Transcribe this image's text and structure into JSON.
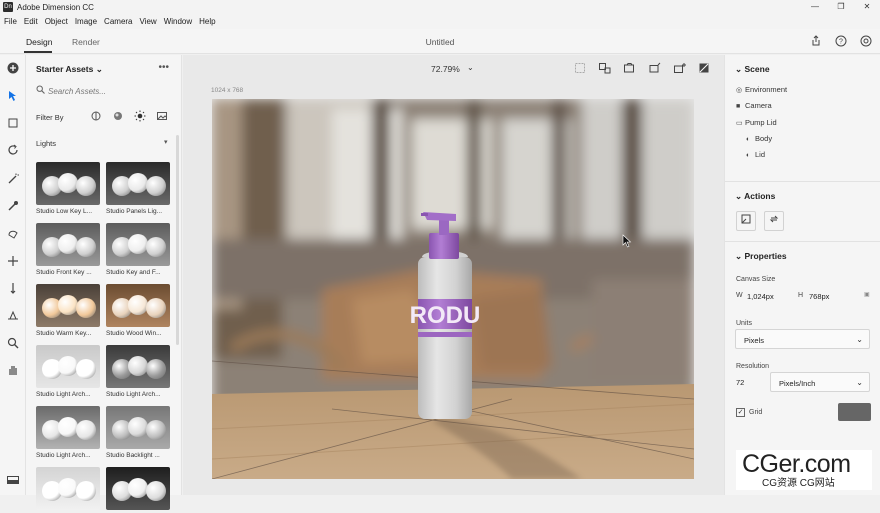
{
  "window": {
    "title": "Adobe Dimension CC",
    "app_icon": "Dn",
    "controls": [
      "—",
      "❐",
      "✕"
    ]
  },
  "menu": [
    "File",
    "Edit",
    "Object",
    "Image",
    "Camera",
    "View",
    "Window",
    "Help"
  ],
  "topbar": {
    "tabs": [
      "Design",
      "Render"
    ],
    "document_title": "Untitled"
  },
  "assets_panel": {
    "header": "Starter Assets",
    "search_placeholder": "Search Assets...",
    "filter_label": "Filter By",
    "section": "Lights",
    "items": [
      {
        "label": "Studio Low Key L...",
        "style": "dark"
      },
      {
        "label": "Studio Panels Lig...",
        "style": "dark"
      },
      {
        "label": "Studio Front Key ...",
        "style": "mid"
      },
      {
        "label": "Studio Key and F...",
        "style": "mid"
      },
      {
        "label": "Studio Warm Key...",
        "style": "warm"
      },
      {
        "label": "Studio Wood Win...",
        "style": "wood"
      },
      {
        "label": "Studio Light Arch...",
        "style": "light"
      },
      {
        "label": "Studio Light Arch...",
        "style": "dark2"
      },
      {
        "label": "Studio Light Arch...",
        "style": "mid2"
      },
      {
        "label": "Studio Backlight ...",
        "style": "mid3"
      },
      {
        "label": "",
        "style": "light2"
      },
      {
        "label": "",
        "style": "dark3"
      }
    ]
  },
  "canvas": {
    "zoom": "72.79%",
    "size_label": "1024 x 768",
    "product_text": "RODU"
  },
  "scene_panel": {
    "title": "Scene",
    "items": [
      {
        "label": "Environment",
        "icon": "environment-icon"
      },
      {
        "label": "Camera",
        "icon": "camera-icon"
      },
      {
        "label": "Pump Lid",
        "icon": "folder-icon"
      },
      {
        "label": "Body",
        "icon": "material-icon"
      },
      {
        "label": "Lid",
        "icon": "material-icon"
      }
    ]
  },
  "actions_panel": {
    "title": "Actions"
  },
  "properties_panel": {
    "title": "Properties",
    "canvas_size_label": "Canvas Size",
    "width_label": "W",
    "width_value": "1,024px",
    "height_label": "H",
    "height_value": "768px",
    "units_label": "Units",
    "units_value": "Pixels",
    "resolution_label": "Resolution",
    "resolution_value": "72",
    "resolution_unit": "Pixels/Inch",
    "grid_label": "Grid",
    "grid_checked": true,
    "grid_color": "#666666"
  },
  "watermark": {
    "main": "CGer.com",
    "sub": "CG资源 CG网站"
  }
}
